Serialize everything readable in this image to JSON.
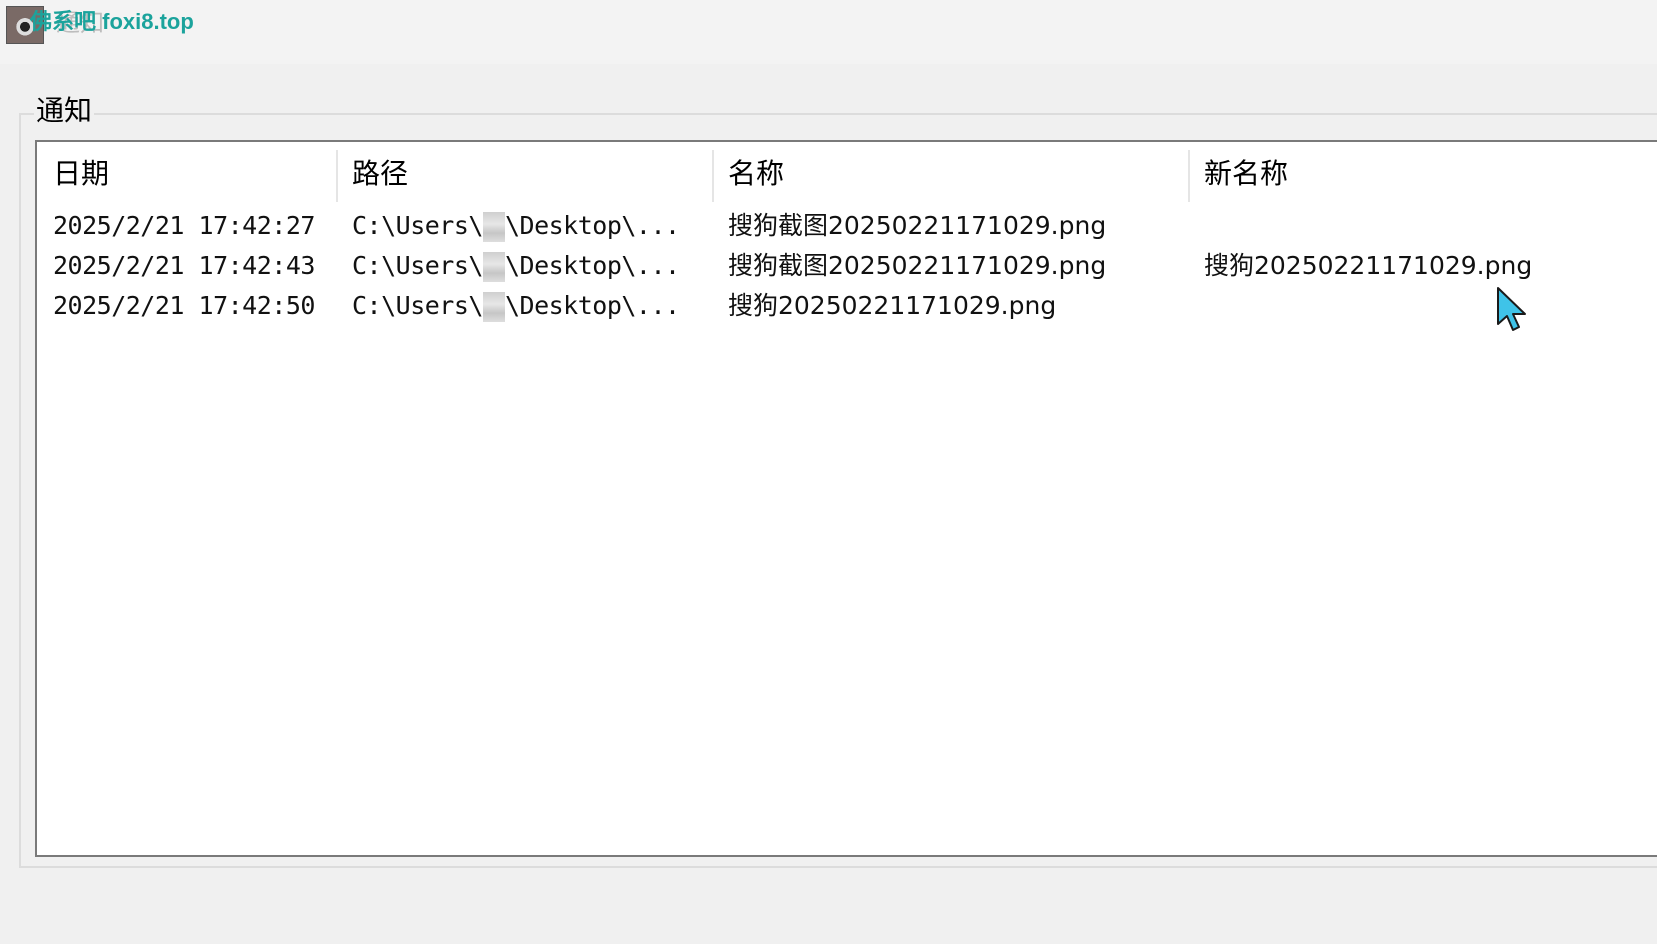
{
  "window": {
    "title": "通知",
    "watermark": "佛系吧 foxi8.top"
  },
  "group": {
    "label": "通知"
  },
  "table": {
    "columns": [
      "日期",
      "路径",
      "名称",
      "新名称"
    ],
    "rows": [
      {
        "date": "2025/2/21 17:42:27",
        "path_prefix": "C:\\Users\\",
        "path_suffix": "\\Desktop\\...",
        "name": "搜狗截图20250221171029.png",
        "new_name": ""
      },
      {
        "date": "2025/2/21 17:42:43",
        "path_prefix": "C:\\Users\\",
        "path_suffix": "\\Desktop\\...",
        "name": "搜狗截图20250221171029.png",
        "new_name": "搜狗20250221171029.png"
      },
      {
        "date": "2025/2/21 17:42:50",
        "path_prefix": "C:\\Users\\",
        "path_suffix": "\\Desktop\\...",
        "name": "搜狗20250221171029.png",
        "new_name": ""
      }
    ]
  },
  "icons": {
    "app": "eye-app-icon",
    "cursor": "mouse-pointer-icon"
  },
  "colors": {
    "watermark": "#1ba39c",
    "cursor": "#3fc3e8"
  }
}
